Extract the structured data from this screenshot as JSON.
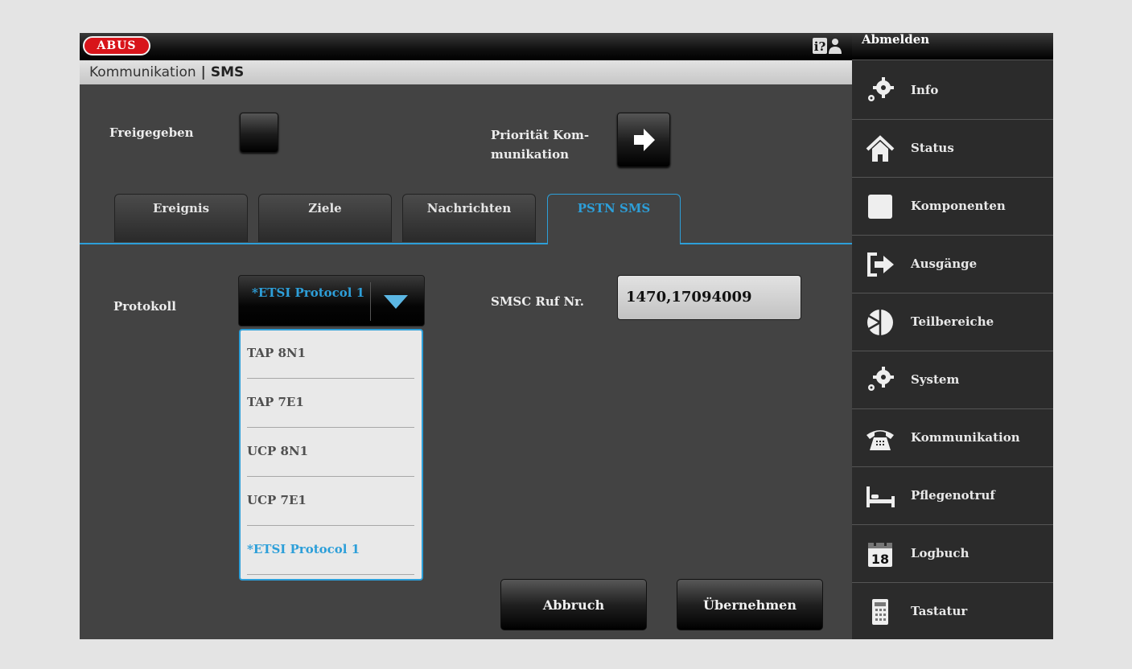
{
  "header": {
    "logo": "ABUS",
    "help_icon": "help-icon",
    "logout_label": "Abmelden"
  },
  "breadcrumb": {
    "section": "Kommunikation",
    "separator": "|",
    "page": "SMS"
  },
  "settings": {
    "enabled_label": "Freigegeben",
    "priority_label": "Priorität Kom- munikation",
    "priority_icon": "arrow-right-icon"
  },
  "tabs": [
    {
      "label": "Ereignis",
      "active": false
    },
    {
      "label": "Ziele",
      "active": false
    },
    {
      "label": "Nachrichten",
      "active": false
    },
    {
      "label": "PSTN SMS",
      "active": true
    }
  ],
  "protocol": {
    "label": "Protokoll",
    "selected": "*ETSI Protocol 1",
    "options": [
      "TAP 8N1",
      "TAP 7E1",
      "UCP 8N1",
      "UCP 7E1",
      "*ETSI Protocol 1"
    ]
  },
  "smsc": {
    "label": "SMSC Ruf Nr.",
    "value": "1470,17094009"
  },
  "actions": {
    "cancel": "Abbruch",
    "apply": "Übernehmen"
  },
  "sidebar": {
    "items": [
      {
        "label": "Info",
        "icon": "gears-icon"
      },
      {
        "label": "Status",
        "icon": "home-icon"
      },
      {
        "label": "Komponenten",
        "icon": "square-icon"
      },
      {
        "label": "Ausgänge",
        "icon": "exit-icon"
      },
      {
        "label": "Teilbereiche",
        "icon": "partition-icon"
      },
      {
        "label": "System",
        "icon": "gears-icon"
      },
      {
        "label": "Kommunikation",
        "icon": "telephone-icon"
      },
      {
        "label": "Pflegenotruf",
        "icon": "bed-icon"
      },
      {
        "label": "Logbuch",
        "icon": "calendar-icon"
      },
      {
        "label": "Tastatur",
        "icon": "keypad-icon"
      }
    ]
  },
  "colors": {
    "accent": "#2d9fd9",
    "panel": "#434343",
    "sidebar": "#2b2b2b",
    "brand": "#d8141a"
  }
}
